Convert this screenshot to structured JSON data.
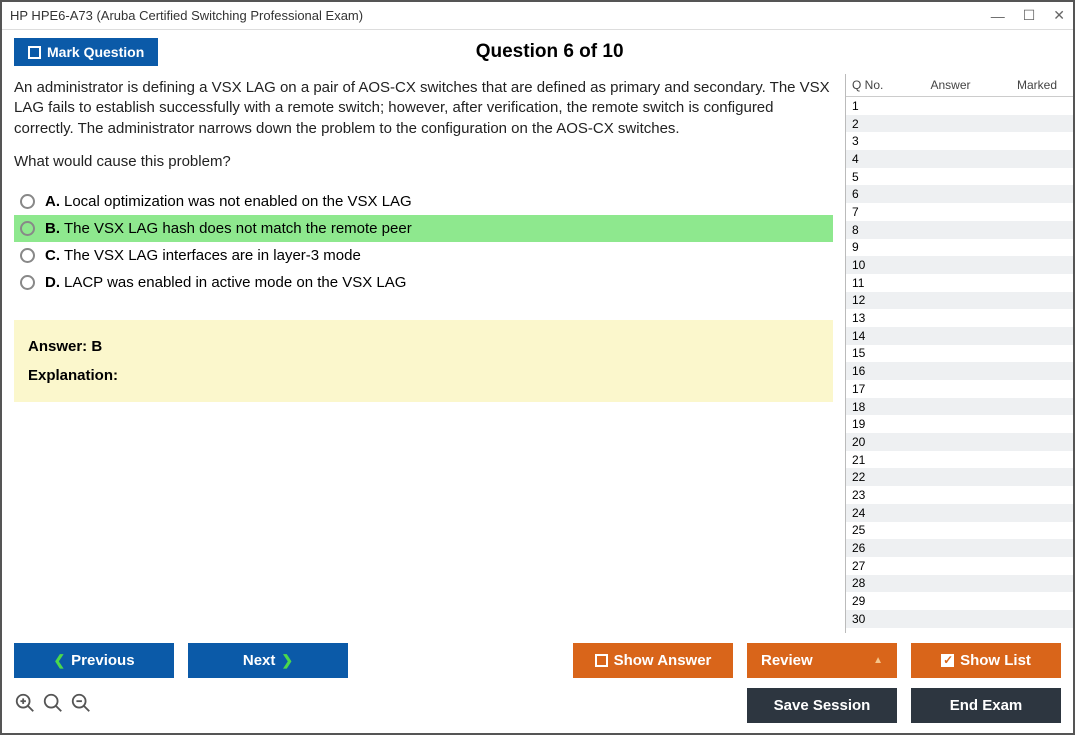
{
  "window": {
    "title": "HP HPE6-A73 (Aruba Certified Switching Professional Exam)"
  },
  "header": {
    "mark_label": "Mark Question",
    "question_number": "Question 6 of 10"
  },
  "question": {
    "text": "An administrator is defining a VSX LAG on a pair of AOS-CX switches that are defined as primary and secondary. The VSX LAG fails to establish successfully with a remote switch; however, after verification, the remote switch is configured correctly. The administrator narrows down the problem to the configuration on the AOS-CX switches.",
    "prompt": "What would cause this problem?",
    "options": {
      "a": {
        "letter": "A.",
        "text": "Local optimization was not enabled on the VSX LAG"
      },
      "b": {
        "letter": "B.",
        "text": "The VSX LAG hash does not match the remote peer"
      },
      "c": {
        "letter": "C.",
        "text": "The VSX LAG interfaces are in layer-3 mode"
      },
      "d": {
        "letter": "D.",
        "text": "LACP was enabled in active mode on the VSX LAG"
      }
    },
    "answer": "Answer: B",
    "explanation_label": "Explanation:"
  },
  "sidebar": {
    "col1": "Q No.",
    "col2": "Answer",
    "col3": "Marked",
    "rows": [
      "1",
      "2",
      "3",
      "4",
      "5",
      "6",
      "7",
      "8",
      "9",
      "10",
      "11",
      "12",
      "13",
      "14",
      "15",
      "16",
      "17",
      "18",
      "19",
      "20",
      "21",
      "22",
      "23",
      "24",
      "25",
      "26",
      "27",
      "28",
      "29",
      "30"
    ]
  },
  "footer": {
    "previous": "Previous",
    "next": "Next",
    "show_answer": "Show Answer",
    "review": "Review",
    "show_list": "Show List",
    "save_session": "Save Session",
    "end_exam": "End Exam"
  }
}
